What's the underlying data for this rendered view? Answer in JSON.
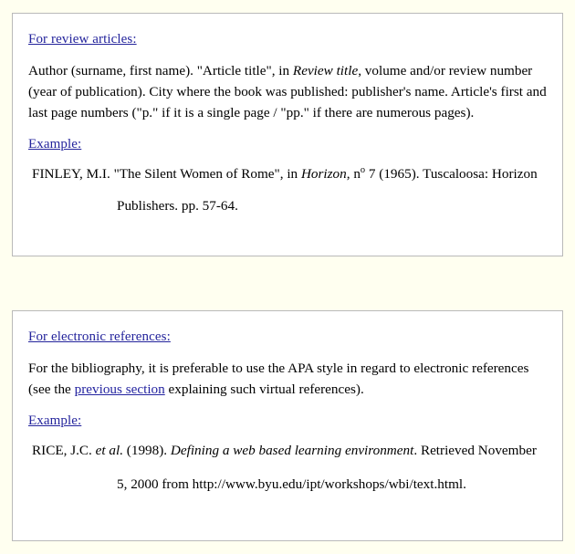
{
  "page": {
    "background_color": "#fffff0",
    "box_background_color": "#ffffff",
    "heading_color": "#24249c",
    "link_color": "#2424a0",
    "text_color": "#000000"
  },
  "boxes": [
    {
      "id": "review-articles",
      "heading": "For review articles:",
      "body": {
        "seg1": "Author (surname, first name).   \"Article title\", in ",
        "italic1": "Review title",
        "seg2": ", volume and/or review number (year of publication).  City where the book was published: publisher's name.  Article's first and last page numbers (\"p.\" if it is a single page / \"pp.\" if there are numerous pages)."
      },
      "example_label": "Example:",
      "example": {
        "line1_seg1": "FINLEY, M.I. \"The Silent Women of Rome\", in ",
        "line1_italic": "Horizon",
        "line1_seg2": ", n",
        "line1_sup": "o",
        "line1_seg3": " 7 (1965).  Tuscaloosa: Horizon",
        "line2": "Publishers.  pp. 57-64."
      }
    },
    {
      "id": "electronic-references",
      "heading": "For electronic references:",
      "body": {
        "seg1": "For the bibliography, it is preferable to use the APA style in regard to electronic references (see the ",
        "link": "previous section",
        "seg2": " explaining such virtual references)."
      },
      "example_label": "Example:",
      "example": {
        "line1_seg1": "RICE, J.C. ",
        "line1_italic1": "et al.",
        "line1_seg2": " (1998).  ",
        "line1_italic2": "Defining a web based learning environment",
        "line1_seg3": ".  Retrieved November",
        "line2": "5, 2000 from http://www.byu.edu/ipt/workshops/wbi/text.html."
      }
    }
  ]
}
